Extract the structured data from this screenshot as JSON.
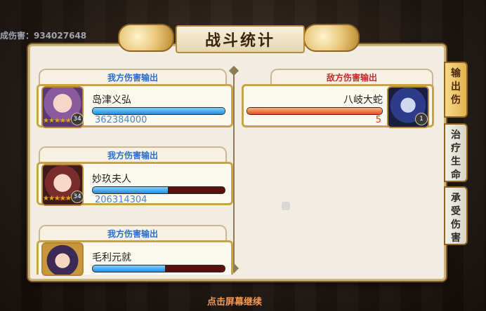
{
  "background_total": "成伤害：934027648",
  "title": "战斗统计",
  "ally_section_label": "我方伤害输出",
  "enemy_section_label": "敌方伤害输出",
  "ally_entries": [
    {
      "name": "岛津义弘",
      "damage": "362384000",
      "level": "34",
      "bar_fraction": 1.0
    },
    {
      "name": "妙玖夫人",
      "damage": "206314304",
      "level": "34",
      "bar_fraction": 0.57
    },
    {
      "name": "毛利元就",
      "damage": "",
      "level": "",
      "bar_fraction": 0.55
    }
  ],
  "enemy_entries": [
    {
      "name": "八岐大蛇",
      "damage": "5",
      "level": "1",
      "bar_fraction": 1.0
    }
  ],
  "tabs": [
    {
      "label": "输出伤害",
      "chars": [
        "输",
        "出",
        "伤",
        "害"
      ],
      "active": true
    },
    {
      "label": "治疗生命",
      "chars": [
        "治",
        "疗",
        "生",
        "命"
      ],
      "active": false
    },
    {
      "label": "承受伤害",
      "chars": [
        "承",
        "受",
        "伤",
        "害"
      ],
      "active": false
    }
  ],
  "continue_hint": "点击屏幕继续",
  "colors": {
    "ally_header": "#2a6fd0",
    "enemy_header": "#c8282a",
    "ally_bar": "#1f8de0",
    "enemy_bar": "#e2531c"
  }
}
